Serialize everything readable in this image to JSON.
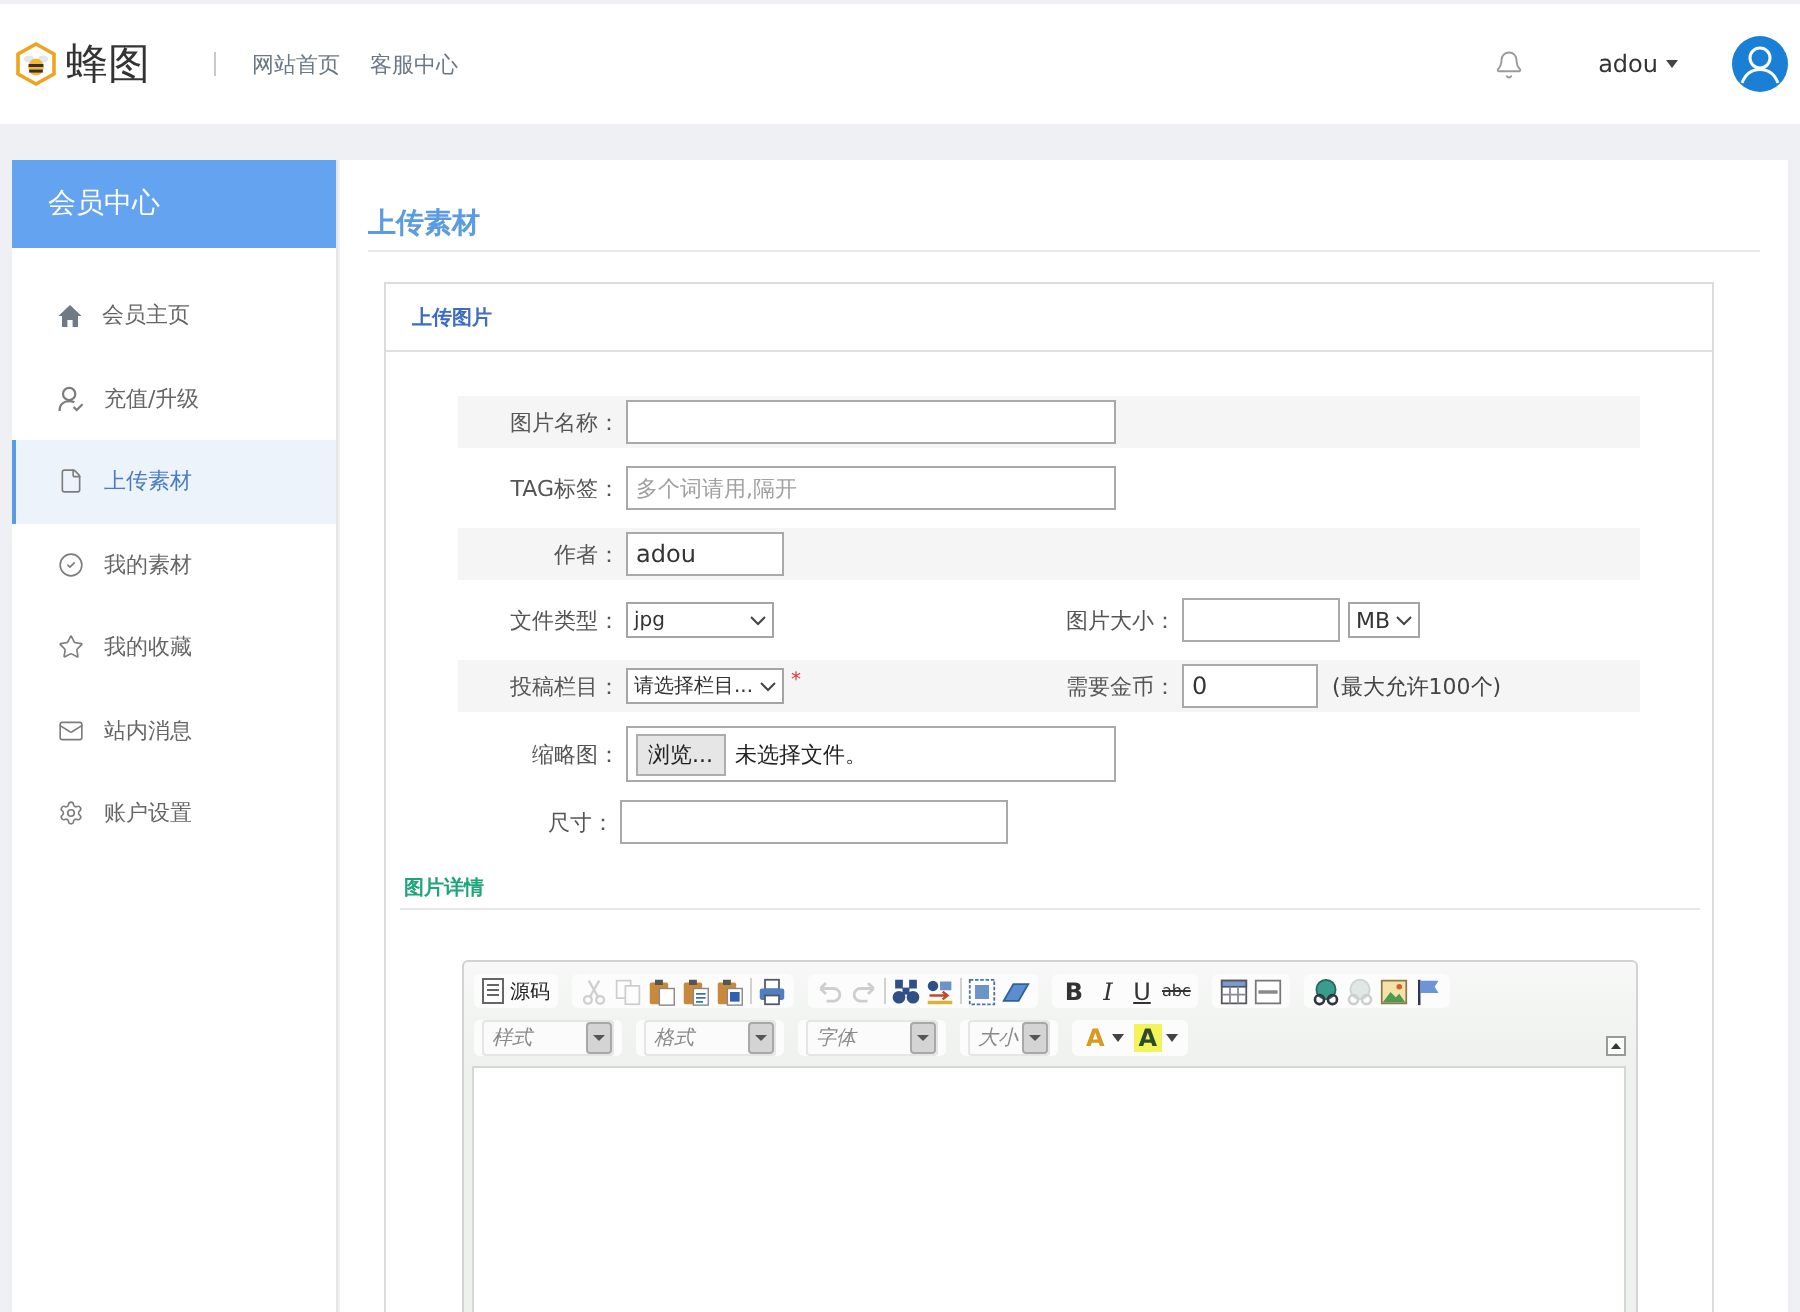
{
  "header": {
    "logo_text": "蜂图",
    "nav_links": [
      "网站首页",
      "客服中心"
    ],
    "username": "adou"
  },
  "sidebar": {
    "title": "会员中心",
    "items": [
      {
        "kind": "home",
        "label": "会员主页",
        "selected": false
      },
      {
        "kind": "user",
        "label": "充值/升级",
        "selected": false
      },
      {
        "kind": "file",
        "label": "上传素材",
        "selected": true
      },
      {
        "kind": "check",
        "label": "我的素材",
        "selected": false
      },
      {
        "kind": "star",
        "label": "我的收藏",
        "selected": false
      },
      {
        "kind": "mail",
        "label": "站内消息",
        "selected": false
      },
      {
        "kind": "gear",
        "label": "账户设置",
        "selected": false
      }
    ]
  },
  "page_title": "上传素材",
  "upload_card": {
    "title": "上传图片",
    "rows": [
      [
        {
          "kind": "text",
          "label": "图片名称："
        }
      ],
      [
        {
          "kind": "text",
          "label": "TAG标签：",
          "placeholder": "多个词请用,隔开"
        }
      ],
      [
        {
          "kind": "short",
          "label": "作者：",
          "value": "adou"
        }
      ],
      [
        {
          "kind": "select",
          "label": "文件类型：",
          "value": "jpg"
        },
        {
          "kind": "unit",
          "label": "图片大小：",
          "unit": "MB"
        }
      ],
      [
        {
          "kind": "select",
          "label": "投稿栏目：",
          "value": "请选择栏目...",
          "required_mark": "*"
        },
        {
          "kind": "number",
          "label": "需要金币：",
          "value": "0",
          "note": "(最大允许100个)"
        }
      ],
      [
        {
          "kind": "file",
          "label": "缩略图：",
          "button": "浏览...",
          "status": "未选择文件。"
        }
      ]
    ],
    "size_field": {
      "label": "尺寸："
    }
  },
  "details": {
    "title": "图片详情",
    "editor": {
      "toolbar_rows": [
        [
          [
            {
              "kind": "source",
              "label": "源码",
              "disabled": false
            }
          ],
          [
            {
              "kind": "cut",
              "disabled": true
            },
            {
              "kind": "copy",
              "disabled": true
            },
            {
              "kind": "paste",
              "disabled": false
            },
            {
              "kind": "paste-text",
              "disabled": false
            },
            {
              "kind": "paste-word",
              "disabled": false
            },
            {
              "kind": "separator"
            },
            {
              "kind": "print",
              "disabled": false
            }
          ],
          [
            {
              "kind": "undo",
              "disabled": true
            },
            {
              "kind": "redo",
              "disabled": true
            },
            {
              "kind": "separator"
            },
            {
              "kind": "find",
              "disabled": false
            },
            {
              "kind": "replace",
              "disabled": false
            },
            {
              "kind": "separator"
            },
            {
              "kind": "select-all",
              "disabled": false
            },
            {
              "kind": "remove-format",
              "disabled": false
            }
          ],
          [
            {
              "kind": "bold",
              "label": "B",
              "disabled": false
            },
            {
              "kind": "italic",
              "label": "I",
              "disabled": false
            },
            {
              "kind": "underline",
              "label": "U",
              "disabled": false
            },
            {
              "kind": "strike",
              "label": "abc",
              "disabled": false
            }
          ],
          [
            {
              "kind": "table",
              "disabled": false
            },
            {
              "kind": "hr",
              "disabled": false
            }
          ],
          [
            {
              "kind": "link",
              "disabled": false
            },
            {
              "kind": "unlink",
              "disabled": true
            },
            {
              "kind": "image",
              "disabled": false
            },
            {
              "kind": "anchor",
              "disabled": false
            }
          ]
        ],
        [
          [
            {
              "kind": "combo",
              "label": "样式"
            }
          ],
          [
            {
              "kind": "combo",
              "label": "格式"
            }
          ],
          [
            {
              "kind": "combo",
              "label": "字体"
            }
          ],
          [
            {
              "kind": "minicombo",
              "label": "大小"
            }
          ],
          [
            {
              "kind": "text-color",
              "label": "A"
            },
            {
              "kind": "bg-color",
              "label": "A"
            }
          ]
        ]
      ]
    }
  }
}
